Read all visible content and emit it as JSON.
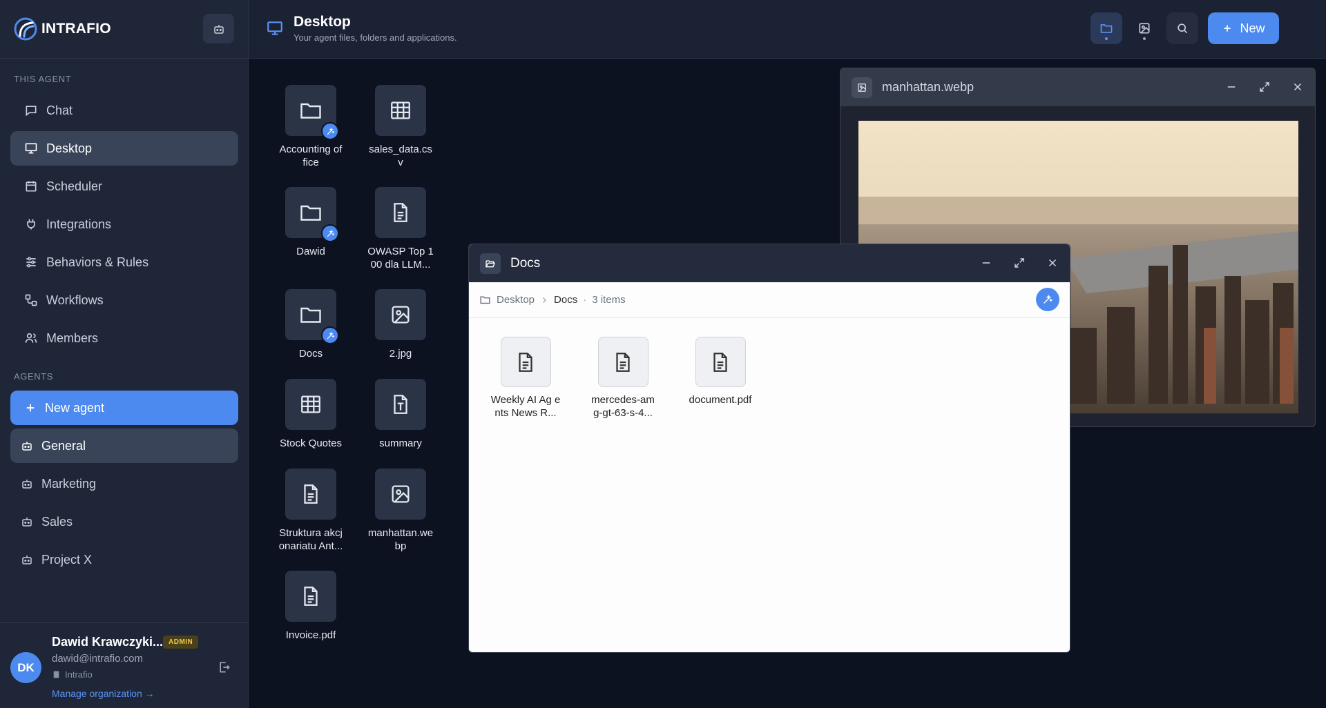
{
  "brand": {
    "name": "INTRAFIO"
  },
  "sidebar": {
    "section_agent": "THIS AGENT",
    "items": [
      {
        "label": "Chat"
      },
      {
        "label": "Desktop"
      },
      {
        "label": "Scheduler"
      },
      {
        "label": "Integrations"
      },
      {
        "label": "Behaviors & Rules"
      },
      {
        "label": "Workflows"
      },
      {
        "label": "Members"
      }
    ],
    "section_agents": "AGENTS",
    "new_agent": "New agent",
    "agents": [
      {
        "label": "General"
      },
      {
        "label": "Marketing"
      },
      {
        "label": "Sales"
      },
      {
        "label": "Project X"
      }
    ]
  },
  "user": {
    "initials": "DK",
    "name": "Dawid Krawczyki...",
    "role": "ADMIN",
    "email": "dawid@intrafio.com",
    "org": "Intrafio",
    "manage": "Manage organization →"
  },
  "header": {
    "title": "Desktop",
    "subtitle": "Your agent files, folders and applications.",
    "new_label": "New"
  },
  "desktop": {
    "items": [
      {
        "label": "Accounting of fice",
        "icon": "folder-icon"
      },
      {
        "label": "sales_data.cs v",
        "icon": "table-icon"
      },
      {
        "label": "Dawid",
        "icon": "folder-icon"
      },
      {
        "label": "OWASP Top 1 00 dla LLM...",
        "icon": "document-icon"
      },
      {
        "label": "Docs",
        "icon": "folder-icon"
      },
      {
        "label": "2.jpg",
        "icon": "image-icon"
      },
      {
        "label": "Stock Quotes",
        "icon": "table-icon"
      },
      {
        "label": "summary",
        "icon": "text-file-icon"
      },
      {
        "label": "Struktura akcj onariatu Ant...",
        "icon": "document-icon"
      },
      {
        "label": "manhattan.we bp",
        "icon": "image-icon"
      },
      {
        "label": "Invoice.pdf",
        "icon": "document-icon"
      }
    ]
  },
  "image_window": {
    "title": "manhattan.webp"
  },
  "docs_window": {
    "title": "Docs",
    "breadcrumb_root": "Desktop",
    "breadcrumb_current": "Docs",
    "separator": "·",
    "count": "3 items",
    "files": [
      {
        "label": "Weekly AI Ag ents News R..."
      },
      {
        "label": "mercedes-am g-gt-63-s-4..."
      },
      {
        "label": "document.pdf"
      }
    ]
  },
  "colors": {
    "accent": "#4d8af0",
    "sidebar_bg": "#1e2638",
    "desktop_bg": "#0d1220",
    "badge": "#f0c94a"
  }
}
